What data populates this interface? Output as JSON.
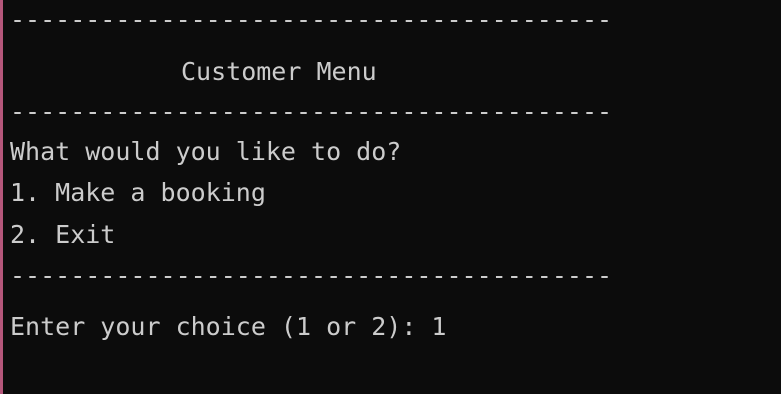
{
  "console": {
    "separator_top": "----------------------------------------",
    "title": "Customer Menu",
    "separator_mid": "----------------------------------------",
    "prompt": "What would you like to do?",
    "options": [
      "1. Make a booking",
      "2. Exit"
    ],
    "separator_bottom": "----------------------------------------",
    "input_line": "Enter your choice (1 or 2): 1"
  },
  "colors": {
    "background": "#0c0c0c",
    "text": "#cccccc",
    "left_border": "#b5577b"
  }
}
